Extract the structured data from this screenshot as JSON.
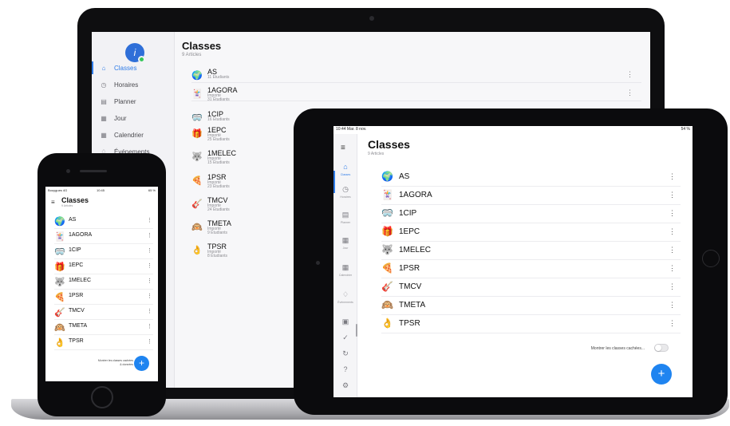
{
  "accent_color": "#1f84f0",
  "laptop": {
    "title": "Classes",
    "subtitle": "9 Articles",
    "nav": [
      {
        "label": "Classes",
        "icon": "home-icon",
        "glyph": "⌂",
        "active": true
      },
      {
        "label": "Horaires",
        "icon": "schedule-icon",
        "glyph": "◷"
      },
      {
        "label": "Planner",
        "icon": "planner-icon",
        "glyph": "▤"
      },
      {
        "label": "Jour",
        "icon": "day-calendar-icon",
        "glyph": "▦"
      },
      {
        "label": "Calendrier",
        "icon": "calendar-icon",
        "glyph": "▦"
      },
      {
        "label": "Événements",
        "icon": "bell-icon",
        "glyph": "♢"
      }
    ],
    "rows": [
      {
        "name": "AS",
        "line1": "11 Étudiants",
        "line2": "",
        "emoji": "🌍"
      },
      {
        "name": "1AGORA",
        "line1": "Importé",
        "line2": "31 Étudiants",
        "emoji": "🃏"
      },
      {
        "name": "1CIP",
        "line1": "16 Étudiants",
        "line2": "",
        "emoji": "🥽"
      },
      {
        "name": "1EPC",
        "line1": "Importé",
        "line2": "25 Étudiants",
        "emoji": "🎁"
      },
      {
        "name": "1MELEC",
        "line1": "Importé",
        "line2": "15 Étudiants",
        "emoji": "🐺"
      },
      {
        "name": "1PSR",
        "line1": "Importé",
        "line2": "23 Étudiants",
        "emoji": "🍕"
      },
      {
        "name": "TMCV",
        "line1": "Importé",
        "line2": "24 Étudiants",
        "emoji": "🎸"
      },
      {
        "name": "TMETA",
        "line1": "Importé",
        "line2": "9 Étudiants",
        "emoji": "🙉"
      },
      {
        "name": "TPSR",
        "line1": "Importé",
        "line2": "8 Étudiants",
        "emoji": "👌"
      }
    ]
  },
  "phone": {
    "status_carrier": "Bouygues 4G",
    "status_time": "10:45",
    "status_battery": "65 %",
    "title": "Classes",
    "subtitle": "9 Articles",
    "rows": [
      {
        "name": "AS",
        "emoji": "🌍"
      },
      {
        "name": "1AGORA",
        "emoji": "🃏"
      },
      {
        "name": "1CIP",
        "emoji": "🥽"
      },
      {
        "name": "1EPC",
        "emoji": "🎁"
      },
      {
        "name": "1MELEC",
        "emoji": "🐺"
      },
      {
        "name": "1PSR",
        "emoji": "🍕"
      },
      {
        "name": "TMCV",
        "emoji": "🎸"
      },
      {
        "name": "TMETA",
        "emoji": "🙉"
      },
      {
        "name": "TPSR",
        "emoji": "👌"
      }
    ],
    "hidden_line1": "Montrer les classes cachées",
    "hidden_line2": "& données",
    "fab": "+"
  },
  "tablet": {
    "status_left": "10:44  Mar. 8 nov.",
    "status_right": "54 %",
    "title": "Classes",
    "subtitle": "9 Articles",
    "rail": [
      {
        "label": "Classes",
        "icon": "home-icon",
        "glyph": "⌂",
        "active": true
      },
      {
        "label": "Horaires",
        "icon": "schedule-icon",
        "glyph": "◷"
      },
      {
        "label": "Planner",
        "icon": "planner-icon",
        "glyph": "▤"
      },
      {
        "label": "Jour",
        "icon": "day-calendar-icon",
        "glyph": "▦"
      },
      {
        "label": "Calendrier",
        "icon": "calendar-icon",
        "glyph": "▦"
      },
      {
        "label": "Événements",
        "icon": "bell-icon",
        "glyph": "♢"
      },
      {
        "label": "",
        "icon": "grade-icon",
        "glyph": "▣"
      },
      {
        "label": "",
        "icon": "check-icon",
        "glyph": "✓"
      },
      {
        "label": "",
        "icon": "sync-icon",
        "glyph": "↻"
      },
      {
        "label": "",
        "icon": "help-icon",
        "glyph": "?"
      },
      {
        "label": "",
        "icon": "settings-icon",
        "glyph": "⚙"
      }
    ],
    "rows": [
      {
        "name": "AS",
        "emoji": "🌍"
      },
      {
        "name": "1AGORA",
        "emoji": "🃏"
      },
      {
        "name": "1CIP",
        "emoji": "🥽"
      },
      {
        "name": "1EPC",
        "emoji": "🎁"
      },
      {
        "name": "1MELEC",
        "emoji": "🐺"
      },
      {
        "name": "1PSR",
        "emoji": "🍕"
      },
      {
        "name": "TMCV",
        "emoji": "🎸"
      },
      {
        "name": "TMETA",
        "emoji": "🙉"
      },
      {
        "name": "TPSR",
        "emoji": "👌"
      }
    ],
    "hidden_label": "Montrer les classes cachées...",
    "hidden_toggle_on": false,
    "fab": "+"
  }
}
